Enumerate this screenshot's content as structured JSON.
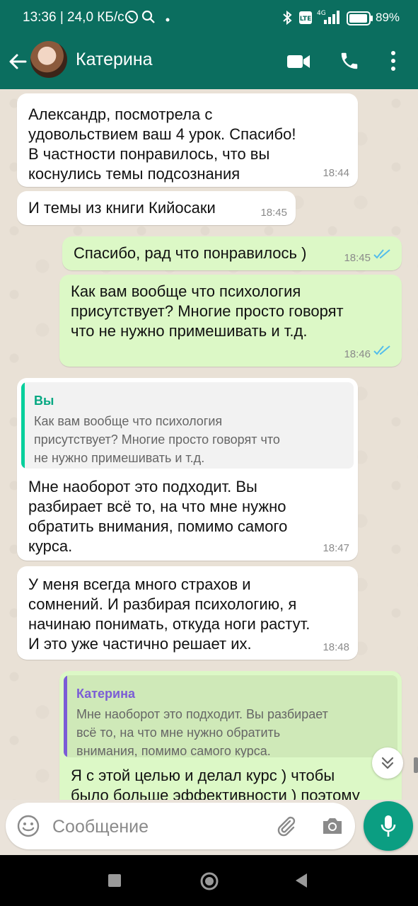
{
  "status_bar": {
    "time": "13:36 | 24,0 КБ/с",
    "network": "4G",
    "battery": "89%"
  },
  "header": {
    "contact_name": "Катерина",
    "icons": [
      "back-arrow-icon",
      "video-call-icon",
      "phone-icon",
      "more-vert-icon"
    ]
  },
  "messages": [
    {
      "dir": "in",
      "text": "Александр, посмотрела с\nудовольствием ваш 4 урок. Спасибо!\nВ частности понравилось, что вы\nкоснулись темы подсознания",
      "time": "18:44"
    },
    {
      "dir": "in",
      "text": "И темы из книги Кийосаки",
      "time": "18:45"
    },
    {
      "dir": "out",
      "text": "Спасибо, рад что понравилось )",
      "time": "18:45",
      "status": "read"
    },
    {
      "dir": "out",
      "text": "Как вам вообще что психология\nприсутствует? Многие просто говорят\nчто не нужно примешивать и т.д.",
      "time": "18:46",
      "status": "read"
    },
    {
      "dir": "in",
      "quote": {
        "author": "Вы",
        "text": "Как вам вообще что психология\nприсутствует? Многие просто говорят что\nне нужно примешивать и т.д."
      },
      "text": "Мне наоборот это подходит. Вы\nразбирает всё то, на что мне нужно\nобратить внимания, помимо самого\nкурса.",
      "time": "18:47"
    },
    {
      "dir": "in",
      "text": "У меня всегда много страхов и\nсомнений. И разбирая психологию, я\nначинаю понимать, откуда ноги растут.\nИ это уже частично решает их.",
      "time": "18:48"
    },
    {
      "dir": "out",
      "quote": {
        "author": "Катерина",
        "text": "Мне наоборот это подходит. Вы разбирает\nвсё то, на что мне нужно обратить\nвнимания, помимо самого курса."
      },
      "text": "Я с этой целью и делал курс ) чтобы\nбыло больше эффективности ) поэтому"
    }
  ],
  "composer": {
    "placeholder": "Сообщение",
    "icons": [
      "emoji-icon",
      "attach-icon",
      "camera-icon",
      "mic-icon"
    ]
  },
  "colors": {
    "header": "#0b6e5f",
    "incoming_bubble": "#ffffff",
    "outgoing_bubble": "#dcf8c6",
    "read_ticks": "#53bdeb",
    "quote_you": "#06cf9c",
    "quote_katerina": "#7b5cd6",
    "mic_button": "#0b9e82"
  }
}
